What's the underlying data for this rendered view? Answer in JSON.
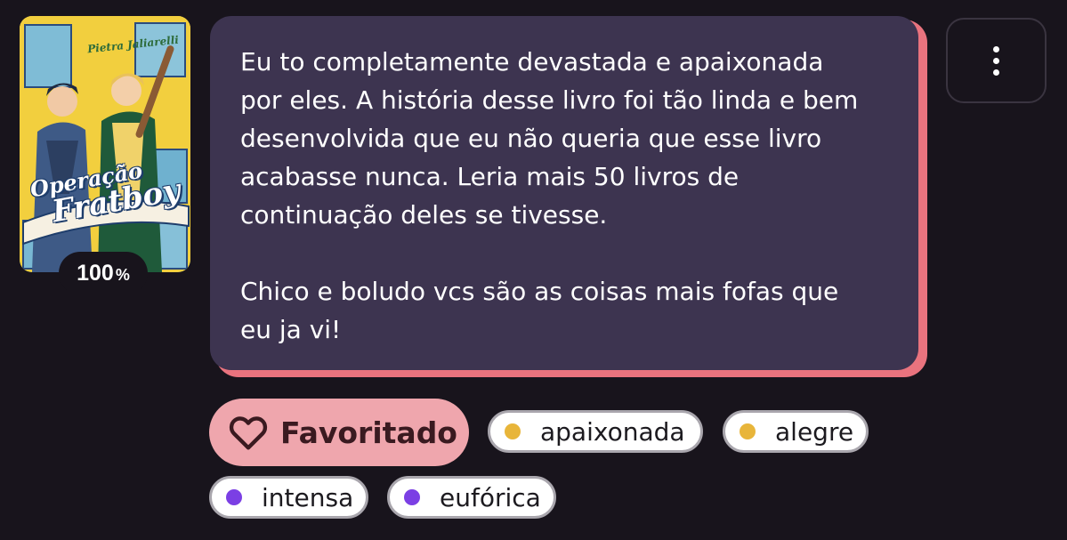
{
  "book": {
    "cover_title_line1": "Operação",
    "cover_title_line2": "Fratboy",
    "cover_author": "Pietra Jaliarelli",
    "progress_number": "100",
    "progress_unit": "%",
    "progress_value": 1.0
  },
  "review": {
    "text": "Eu to completamente devastada e apaixonada\npor eles. A história desse livro foi tão linda e bem\ndesenvolvida que eu não queria que esse livro\nacabasse nunca. Leria mais 50 livros de\ncontinuação deles se tivesse.\n\nChico e boludo vcs são as coisas mais fofas que\neu ja vi!"
  },
  "actions": {
    "options_icon": "more-vertical-icon",
    "favorite_label": "Favoritado",
    "favorite_icon": "heart-outline-icon"
  },
  "moods": [
    {
      "label": "apaixonada",
      "color": "#e8b53a"
    },
    {
      "label": "alegre",
      "color": "#e8b53a"
    },
    {
      "label": "intensa",
      "color": "#7b3fe4"
    },
    {
      "label": "eufórica",
      "color": "#7b3fe4"
    }
  ],
  "colors": {
    "background": "#18141c",
    "bubble": "#3d3450",
    "bubble_shadow": "#e9737e",
    "favorite_button": "#efa6ad"
  }
}
